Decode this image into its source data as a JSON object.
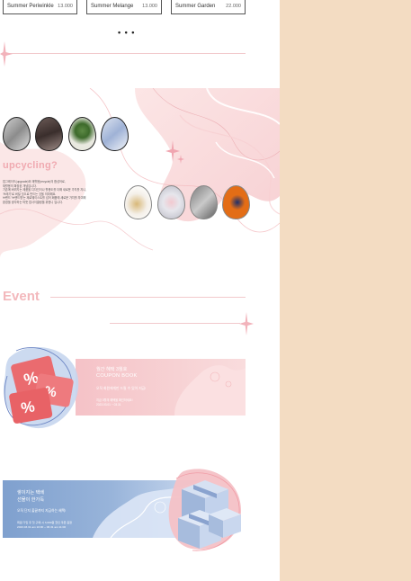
{
  "products": [
    {
      "name": "Summer Periwinkle",
      "price": "13.000"
    },
    {
      "name": "Summer Melange",
      "price": "13.000"
    },
    {
      "name": "Summer Garden",
      "price": "22.000"
    }
  ],
  "more_indicator": "• • •",
  "upcycling": {
    "title": "upcycling?",
    "lines": [
      "업그레이드(upgrade)와 재활용(recycle)의 합성어로,",
      "재활용의 확장된 개념입니다.",
      "기존에 버려지는 제품을 디자인이나 활용도를 더해 새로운 가치를 지니,",
      "'쓰레기'로 버릴 것으로 만드는 것을 의미해요.",
      "브랜드 '브랜드명'는 제로웨이스트를 넘어 폐품에 새로운 가치를 부여해",
      "환경을 생각하는 따뜻 업사이클링을 위한니 입니다."
    ]
  },
  "event": {
    "title": "Event",
    "coupon": {
      "heading1": "월간 혜택 3월호",
      "heading2": "COUPON BOOK",
      "line1": "오직 회원에게만 드릴 수 있어 지금!",
      "line2": "지금 3월의 혜택을 확인하세요!",
      "dates": "2023.03.01 ~ 03.31"
    },
    "box": {
      "heading1": "쌓이지는 택배",
      "heading2": "선물이 한가득",
      "line1": "오직 단지 출끝까지 지금하는 혜택!",
      "line2": "회원 가입 후 첫 구매 시 3,000원 할인 쿠폰 증정",
      "dates": "2023.03.31 am 10:00 ~ 06.31 am 11:00"
    }
  },
  "colors": {
    "page_bg": "#f3dcc2",
    "accent_pink": "#f3b8bc",
    "coupon_pink": "#f5c2c7",
    "box_blue": "#7fa0ce"
  }
}
